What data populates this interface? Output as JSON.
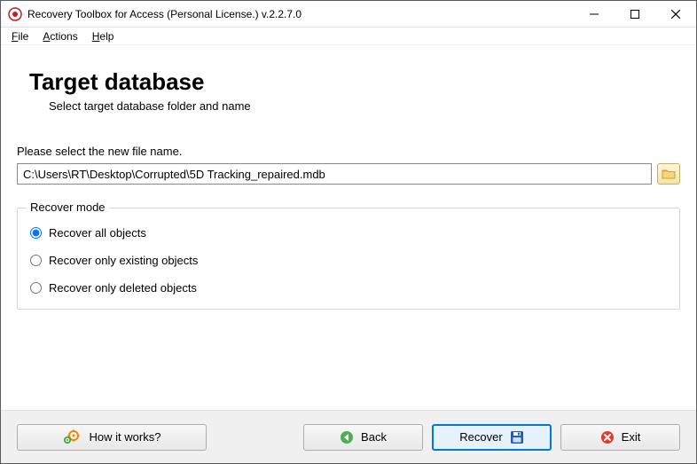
{
  "window": {
    "title": "Recovery Toolbox for Access (Personal License.) v.2.2.7.0"
  },
  "menu": {
    "file": "File",
    "actions": "Actions",
    "help": "Help"
  },
  "page": {
    "heading": "Target database",
    "subheading": "Select target database folder and name",
    "prompt": "Please select the new file name.",
    "file_value": "C:\\Users\\RT\\Desktop\\Corrupted\\5D Tracking_repaired.mdb"
  },
  "recover_mode": {
    "legend": "Recover mode",
    "options": [
      {
        "label": "Recover all objects",
        "checked": true
      },
      {
        "label": "Recover only existing objects",
        "checked": false
      },
      {
        "label": "Recover only deleted objects",
        "checked": false
      }
    ]
  },
  "buttons": {
    "how_it_works": "How it works?",
    "back": "Back",
    "recover": "Recover",
    "exit": "Exit"
  }
}
